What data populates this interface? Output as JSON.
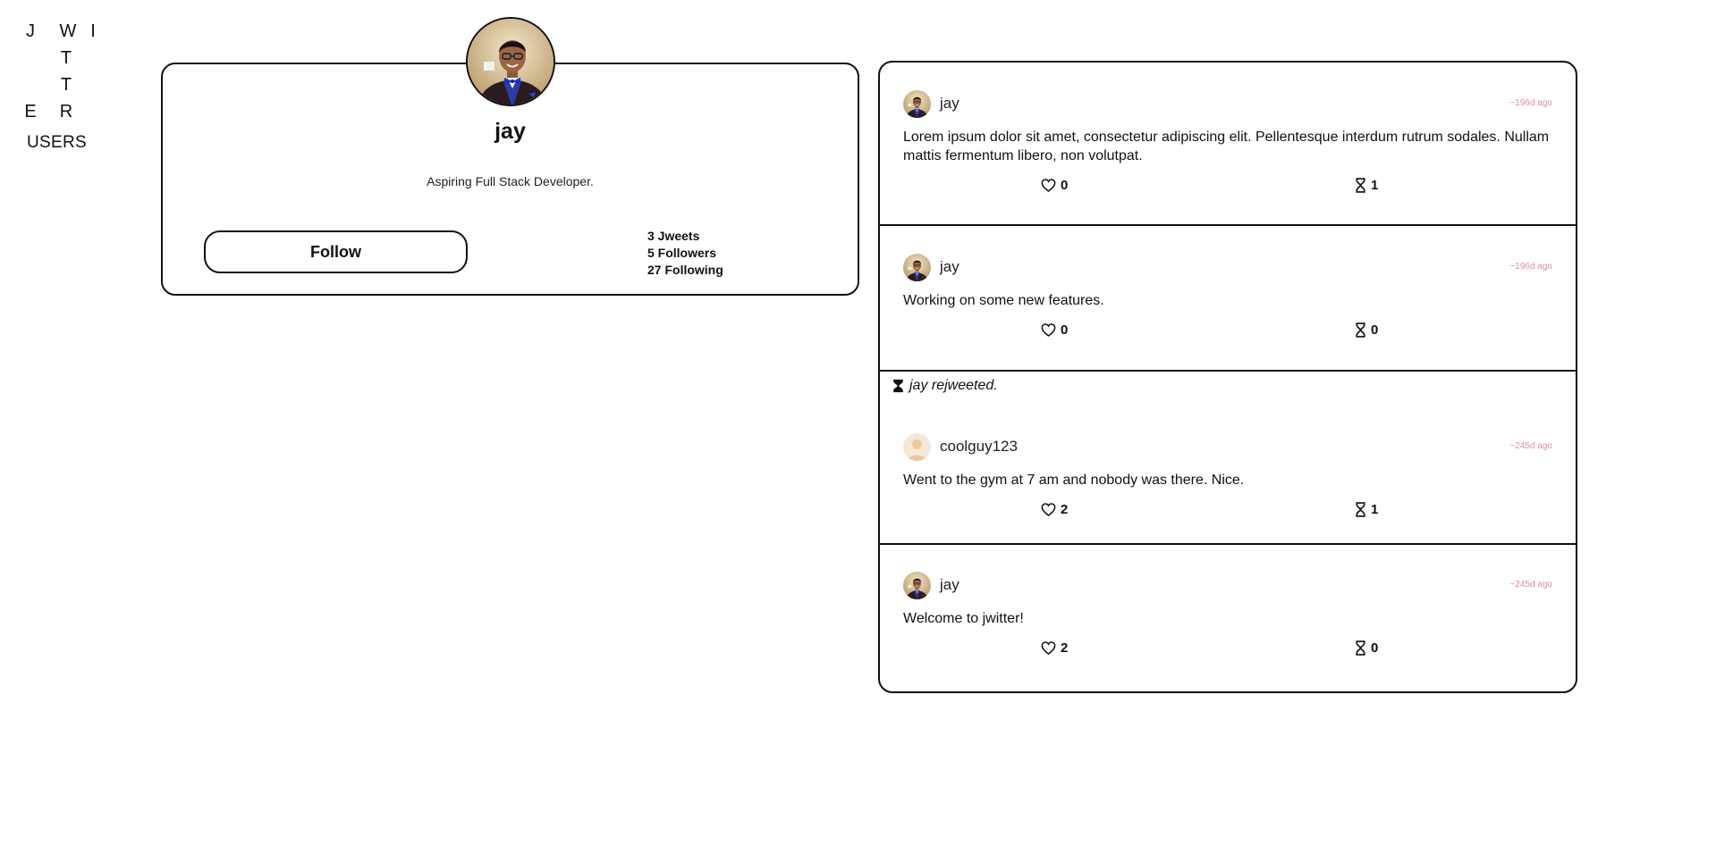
{
  "logo": {
    "letters": [
      "J",
      "W",
      "I",
      "T",
      "T",
      "E",
      "R"
    ]
  },
  "nav": {
    "users_label": "USERS"
  },
  "profile": {
    "name": "jay",
    "bio": "Aspiring Full Stack Developer.",
    "follow_label": "Follow",
    "stats": {
      "jweets": "3 Jweets",
      "followers": "5 Followers",
      "following": "27 Following"
    }
  },
  "feed": {
    "jweets": [
      {
        "username": "jay",
        "timestamp": "~196d ago",
        "text": "Lorem ipsum dolor sit amet, consectetur adipiscing elit. Pellentesque interdum rutrum sodales. Nullam mattis fermentum libero, non volutpat.",
        "likes": "0",
        "rejweets": "1",
        "avatar": "man-in-tuxedo"
      },
      {
        "username": "jay",
        "timestamp": "~196d ago",
        "text": "Working on some new features.",
        "likes": "0",
        "rejweets": "0",
        "avatar": "man-in-tuxedo"
      },
      {
        "rejweet_note": "jay rejweeted.",
        "username": "coolguy123",
        "timestamp": "~245d ago",
        "text": "Went to the gym at 7 am and nobody was there. Nice.",
        "likes": "2",
        "rejweets": "1",
        "avatar": "default-user"
      },
      {
        "username": "jay",
        "timestamp": "~245d ago",
        "text": "Welcome to jwitter!",
        "likes": "2",
        "rejweets": "0",
        "avatar": "man-in-tuxedo"
      }
    ]
  },
  "colors": {
    "border": "#111111",
    "timestamp": "#e08aa8",
    "background": "#ffffff"
  }
}
